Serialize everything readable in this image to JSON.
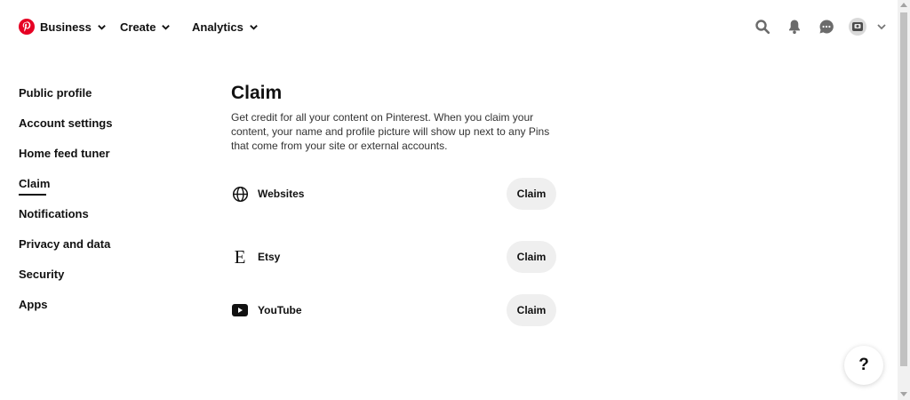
{
  "header": {
    "nav": [
      {
        "label": "Business"
      },
      {
        "label": "Create"
      },
      {
        "label": "Analytics"
      }
    ],
    "icons": [
      "pinterest-logo",
      "search-icon",
      "bell-icon",
      "chat-icon",
      "avatar",
      "chevron-down-icon"
    ]
  },
  "sidebar": {
    "items": [
      {
        "label": "Public profile"
      },
      {
        "label": "Account settings"
      },
      {
        "label": "Home feed tuner"
      },
      {
        "label": "Claim",
        "active": true
      },
      {
        "label": "Notifications"
      },
      {
        "label": "Privacy and data"
      },
      {
        "label": "Security"
      },
      {
        "label": "Apps"
      }
    ]
  },
  "main": {
    "title": "Claim",
    "description": "Get credit for all your content on Pinterest. When you claim your content, your name and profile picture will show up next to any Pins that come from your site or external accounts.",
    "rows": [
      {
        "label": "Websites",
        "icon": "globe-icon",
        "button": "Claim"
      },
      {
        "label": "Etsy",
        "icon": "etsy-icon",
        "icon_text": "E",
        "button": "Claim"
      },
      {
        "label": "YouTube",
        "icon": "youtube-icon",
        "button": "Claim"
      }
    ]
  },
  "help": {
    "label": "?"
  },
  "colors": {
    "brand": "#e60023",
    "button_bg": "#efefef",
    "text": "#111111"
  }
}
